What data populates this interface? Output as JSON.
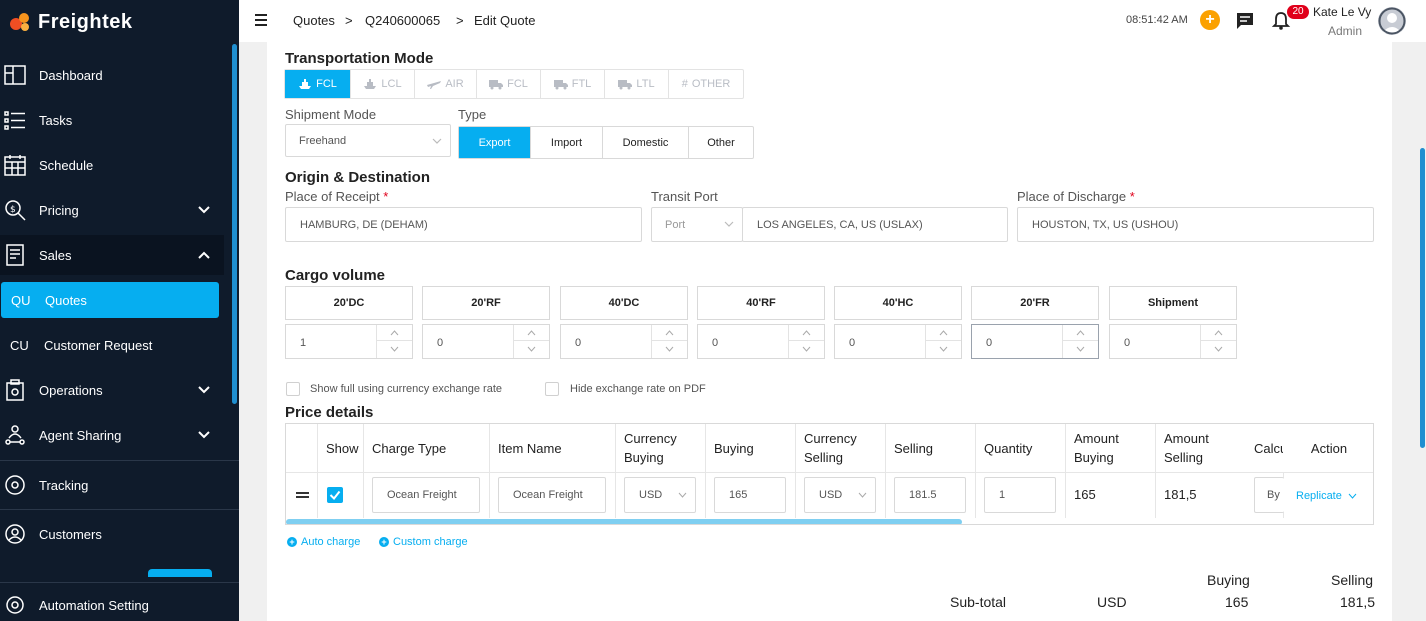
{
  "app": {
    "name": "Freightek"
  },
  "sidebar": {
    "items": [
      {
        "label": "Dashboard",
        "icon": "dashboard-icon"
      },
      {
        "label": "Tasks",
        "icon": "tasks-icon"
      },
      {
        "label": "Schedule",
        "icon": "calendar-icon"
      },
      {
        "label": "Pricing",
        "icon": "pricing-icon"
      },
      {
        "label": "Sales",
        "icon": "sales-icon"
      },
      {
        "label": "Operations",
        "icon": "operations-icon"
      },
      {
        "label": "Agent Sharing",
        "icon": "agent-sharing-icon"
      },
      {
        "label": "Tracking",
        "icon": "tracking-icon"
      },
      {
        "label": "Customers",
        "icon": "customers-icon"
      },
      {
        "label": "Automation Setting",
        "icon": "automation-icon"
      }
    ],
    "sales_sub": [
      {
        "abbr": "QU",
        "label": "Quotes"
      },
      {
        "abbr": "CU",
        "label": "Customer Request"
      }
    ]
  },
  "header": {
    "breadcrumb": [
      "Quotes",
      "Q240600065",
      "Edit Quote"
    ],
    "separator": ">",
    "time": "08:51:42 AM",
    "notif_count": "20",
    "user_name": "Kate Le Vy",
    "user_role": "Admin"
  },
  "transport": {
    "title": "Transportation Mode",
    "modes": [
      "FCL",
      "LCL",
      "AIR",
      "FCL",
      "FTL",
      "LTL",
      "OTHER"
    ],
    "active_mode": 0
  },
  "shipment": {
    "label": "Shipment Mode",
    "value": "Freehand",
    "type_label": "Type",
    "types": [
      "Export",
      "Import",
      "Domestic",
      "Other"
    ],
    "active_type": 0
  },
  "origin": {
    "title": "Origin & Destination",
    "receipt_label": "Place of Receipt",
    "receipt_value": "HAMBURG, DE (DEHAM)",
    "transit_label": "Transit Port",
    "transit_type": "Port",
    "transit_value": "LOS ANGELES, CA, US (USLAX)",
    "discharge_label": "Place of Discharge",
    "discharge_value": "HOUSTON, TX, US (USHOU)",
    "required_mark": "*"
  },
  "cargo": {
    "title": "Cargo volume",
    "containers": [
      {
        "name": "20'DC",
        "qty": "1"
      },
      {
        "name": "20'RF",
        "qty": "0"
      },
      {
        "name": "40'DC",
        "qty": "0"
      },
      {
        "name": "40'RF",
        "qty": "0"
      },
      {
        "name": "40'HC",
        "qty": "0"
      },
      {
        "name": "20'FR",
        "qty": "0"
      },
      {
        "name": "Shipment",
        "qty": "0"
      }
    ]
  },
  "options": {
    "show_full": "Show full using currency exchange rate",
    "hide_rate": "Hide exchange rate on PDF"
  },
  "price": {
    "title": "Price details",
    "headers": [
      "Show",
      "Charge Type",
      "Item Name",
      "Currency Buying",
      "Buying",
      "Currency Selling",
      "Selling",
      "Quantity",
      "Amount Buying",
      "Amount Selling",
      "Calcu",
      "Action"
    ],
    "row": {
      "charge_type": "Ocean Freight",
      "item_name": "Ocean Freight",
      "currency_buying": "USD",
      "buying": "165",
      "currency_selling": "USD",
      "selling": "181.5",
      "quantity": "1",
      "amount_buying": "165",
      "amount_selling": "181,5",
      "calc": "By",
      "action": "Replicate"
    },
    "auto_charge": "Auto charge",
    "custom_charge": "Custom charge"
  },
  "totals": {
    "buying_label": "Buying",
    "selling_label": "Selling",
    "subtotal_label": "Sub-total",
    "currency": "USD",
    "buying": "165",
    "selling": "181,5"
  },
  "colors": {
    "accent": "#06aef0",
    "sidebar": "#0f1b2b",
    "orange": "#fba100",
    "badge": "#e0001b"
  }
}
